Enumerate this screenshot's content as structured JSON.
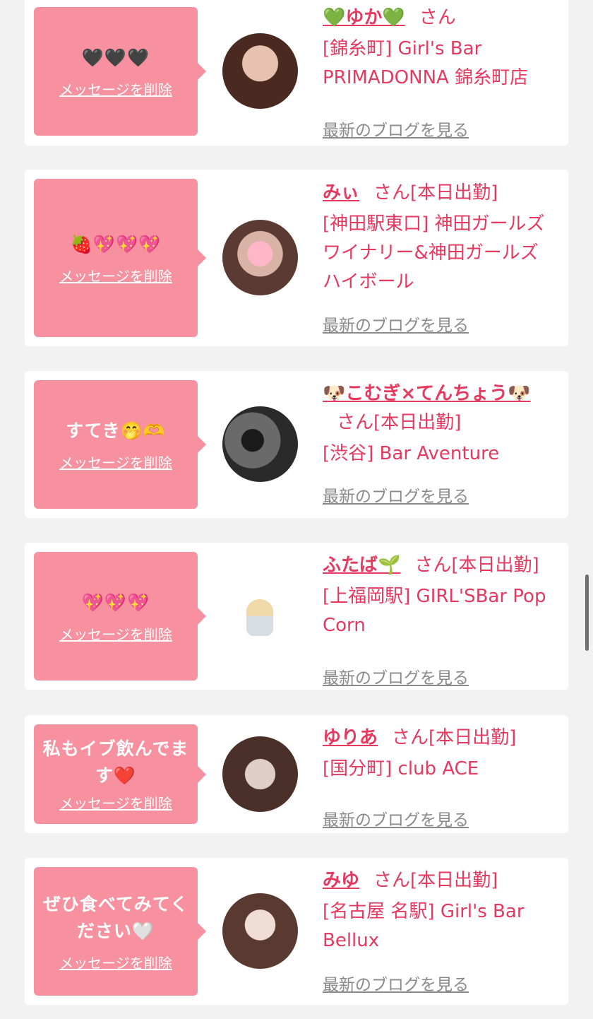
{
  "cards": [
    {
      "message": "🖤🖤🖤",
      "delete_label": "メッセージを削除",
      "name": "💚ゆか💚",
      "suffix": "さん",
      "shop": "[錦糸町] Girl's Bar PRIMADONNA 錦糸町店",
      "blog_label": "最新のブログを見る",
      "avatar_color": "#6b3a2a"
    },
    {
      "message": "🍓💖💖💖",
      "delete_label": "メッセージを削除",
      "name": "みぃ",
      "suffix": "さん[本日出勤]",
      "shop": "[神田駅東口] 神田ガールズワイナリー&神田ガールズハイボール",
      "blog_label": "最新のブログを見る",
      "avatar_color": "#7a5a50"
    },
    {
      "message": "すてき🤭🫶",
      "delete_label": "メッセージを削除",
      "name": "🐶こむぎ×てんちょう🐶",
      "suffix": "さん[本日出勤]",
      "shop": "[渋谷] Bar Aventure",
      "blog_label": "最新のブログを見る",
      "avatar_color": "#3a3a3a"
    },
    {
      "message": "💖💖💖",
      "delete_label": "メッセージを削除",
      "name": "ふたば🌱",
      "suffix": "さん[本日出勤]",
      "shop": "[上福岡駅] GIRL'SBar Pop Corn",
      "blog_label": "最新のブログを見る",
      "avatar_color": "#ffffff"
    },
    {
      "message": "私もイブ飲んでます❤️",
      "delete_label": "メッセージを削除",
      "name": "ゆりあ",
      "suffix": "さん[本日出勤]",
      "shop": "[国分町] club ACE",
      "blog_label": "最新のブログを見る",
      "avatar_color": "#6a5048"
    },
    {
      "message": "ぜひ食べてみてください🤍",
      "delete_label": "メッセージを削除",
      "name": "みゆ",
      "suffix": "さん[本日出勤]",
      "shop": "[名古屋 名駅] Girl's Bar Bellux",
      "blog_label": "最新のブログを見る",
      "avatar_color": "#5a4038"
    }
  ]
}
